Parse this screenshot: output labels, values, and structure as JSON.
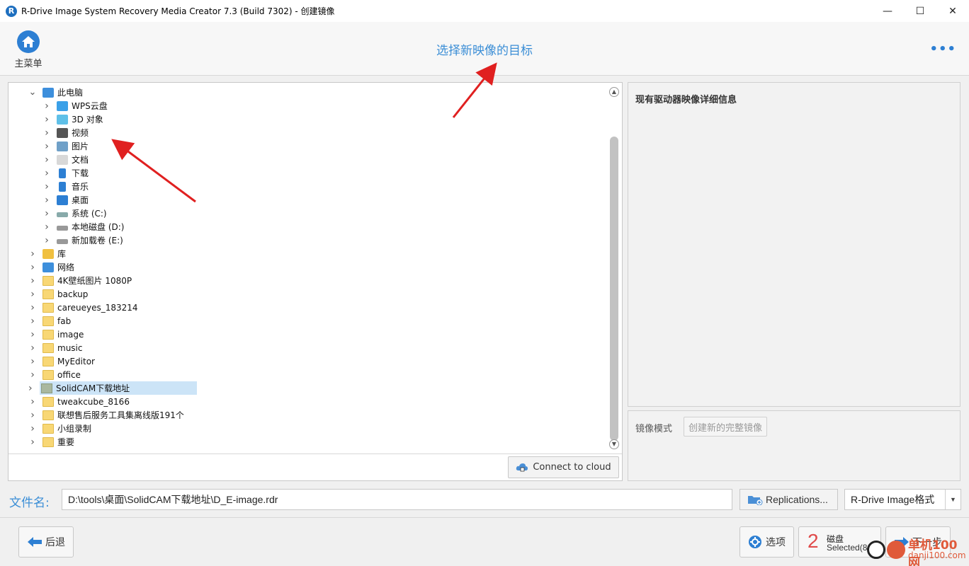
{
  "window": {
    "title": "R-Drive Image System Recovery Media Creator 7.3 (Build 7302) - 创建镜像",
    "logo_letter": "R",
    "minimize": "—",
    "maximize": "☐",
    "close": "✕"
  },
  "header": {
    "home_label": "主菜单",
    "title": "选择新映像的目标",
    "more": "•••"
  },
  "tree": {
    "items": [
      {
        "label": "此电脑",
        "icon": "computer-icon",
        "level": 1,
        "expanded": true
      },
      {
        "label": "WPS云盘",
        "icon": "cloud-icon",
        "level": 2
      },
      {
        "label": "3D 对象",
        "icon": "3d-objects-icon",
        "level": 2
      },
      {
        "label": "视频",
        "icon": "video-icon",
        "level": 2
      },
      {
        "label": "图片",
        "icon": "picture-icon",
        "level": 2
      },
      {
        "label": "文档",
        "icon": "document-icon",
        "level": 2
      },
      {
        "label": "下载",
        "icon": "download-icon",
        "level": 2
      },
      {
        "label": "音乐",
        "icon": "music-icon",
        "level": 2
      },
      {
        "label": "桌面",
        "icon": "desktop-icon",
        "level": 2
      },
      {
        "label": "系统 (C:)",
        "icon": "system-drive-icon",
        "level": 2
      },
      {
        "label": "本地磁盘 (D:)",
        "icon": "drive-icon",
        "level": 2
      },
      {
        "label": "新加载卷 (E:)",
        "icon": "drive-icon",
        "level": 2
      },
      {
        "label": "库",
        "icon": "library-icon",
        "level": 1
      },
      {
        "label": "网络",
        "icon": "network-icon",
        "level": 1
      },
      {
        "label": "4K壁纸图片 1080P",
        "icon": "folder-icon",
        "level": 1
      },
      {
        "label": "backup",
        "icon": "folder-icon",
        "level": 1
      },
      {
        "label": "careueyes_183214",
        "icon": "folder-icon",
        "level": 1
      },
      {
        "label": "fab",
        "icon": "folder-icon",
        "level": 1
      },
      {
        "label": "image",
        "icon": "folder-icon",
        "level": 1
      },
      {
        "label": "music",
        "icon": "folder-icon",
        "level": 1
      },
      {
        "label": "MyEditor",
        "icon": "folder-icon",
        "level": 1
      },
      {
        "label": "office",
        "icon": "folder-icon",
        "level": 1
      },
      {
        "label": "SolidCAM下载地址",
        "icon": "folder-icon",
        "level": 1,
        "selected": true
      },
      {
        "label": "tweakcube_8166",
        "icon": "folder-icon",
        "level": 1
      },
      {
        "label": "联想售后服务工具集离线版191个",
        "icon": "folder-icon",
        "level": 1
      },
      {
        "label": "小组录制",
        "icon": "folder-icon",
        "level": 1
      },
      {
        "label": "重要",
        "icon": "folder-icon",
        "level": 1
      }
    ],
    "connect_cloud": "Connect to cloud"
  },
  "details": {
    "title": "现有驱动器映像详细信息"
  },
  "mode": {
    "label": "镜像模式",
    "button": "创建新的完整镜像"
  },
  "filename": {
    "label": "文件名:",
    "value": "D:\\tools\\桌面\\SolidCAM下载地址\\D_E-image.rdr",
    "replications": "Replications...",
    "format": "R-Drive Image格式"
  },
  "bottom": {
    "back": "后退",
    "options": "选项",
    "disk_count": "2",
    "disk_label": "磁盘",
    "disk_selected": "Selected(8",
    "next": "下一步"
  },
  "watermark": {
    "line1": "单机100网",
    "line2": "danji100.com"
  },
  "colors": {
    "accent": "#2d7fd3",
    "title_blue": "#3b8ed6",
    "selection": "#cce4f7",
    "arrow_red": "#e02020"
  }
}
